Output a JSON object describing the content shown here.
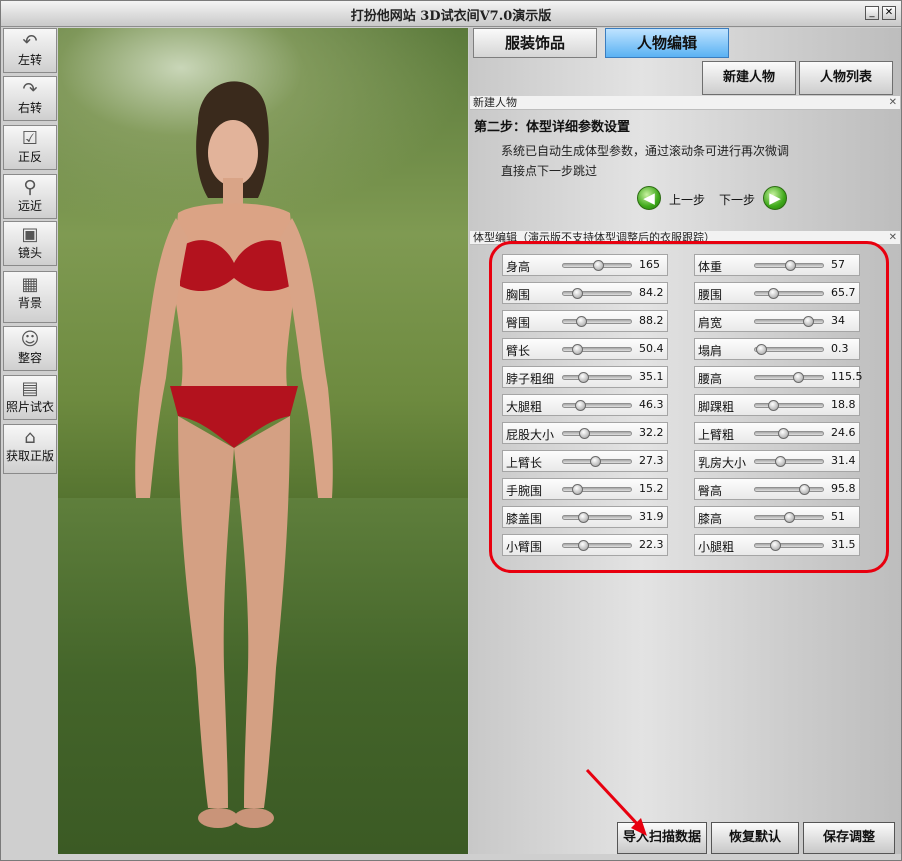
{
  "window": {
    "title": "打扮他网站 3D试衣间V7.0演示版"
  },
  "toolbar": [
    {
      "label": "左转",
      "icon": "rotate-left-icon"
    },
    {
      "label": "右转",
      "icon": "rotate-right-icon"
    },
    {
      "label": "正反",
      "icon": "flip-icon"
    },
    {
      "label": "远近",
      "icon": "zoom-icon"
    },
    {
      "label": "镜头",
      "icon": "camera-icon"
    },
    {
      "label": "背景",
      "icon": "background-icon"
    },
    {
      "label": "整容",
      "icon": "face-icon"
    },
    {
      "label": "照片试衣",
      "icon": "film-icon"
    },
    {
      "label": "获取正版",
      "icon": "home-icon"
    }
  ],
  "tabs": {
    "clothing": "服装饰品",
    "person": "人物编辑"
  },
  "top_buttons": {
    "new_person": "新建人物",
    "person_list": "人物列表"
  },
  "section_new": {
    "header": "新建人物",
    "step_title": "第二步：体型详细参数设置",
    "desc1": "系统已自动生成体型参数，通过滚动条可进行再次微调",
    "desc2": "直接点下一步跳过",
    "prev": "上一步",
    "next": "下一步"
  },
  "section_body": {
    "header": "体型编辑（演示版不支持体型调整后的衣服跟踪）"
  },
  "params_left": [
    {
      "name": "身高",
      "value": "165",
      "level": 0.5
    },
    {
      "name": "胸围",
      "value": "84.2",
      "level": 0.2
    },
    {
      "name": "臀围",
      "value": "88.2",
      "level": 0.25
    },
    {
      "name": "臂长",
      "value": "50.4",
      "level": 0.2
    },
    {
      "name": "脖子粗细",
      "value": "35.1",
      "level": 0.28
    },
    {
      "name": "大腿粗",
      "value": "46.3",
      "level": 0.24
    },
    {
      "name": "屁股大小",
      "value": "32.2",
      "level": 0.3
    },
    {
      "name": "上臂长",
      "value": "27.3",
      "level": 0.45
    },
    {
      "name": "手腕围",
      "value": "15.2",
      "level": 0.2
    },
    {
      "name": "膝盖围",
      "value": "31.9",
      "level": 0.28
    },
    {
      "name": "小臂围",
      "value": "22.3",
      "level": 0.28
    }
  ],
  "params_right": [
    {
      "name": "体重",
      "value": "57",
      "level": 0.5
    },
    {
      "name": "腰围",
      "value": "65.7",
      "level": 0.26
    },
    {
      "name": "肩宽",
      "value": "34",
      "level": 0.75
    },
    {
      "name": "塌肩",
      "value": "0.3",
      "level": 0.08
    },
    {
      "name": "腰高",
      "value": "115.5",
      "level": 0.62
    },
    {
      "name": "脚踝粗",
      "value": "18.8",
      "level": 0.26
    },
    {
      "name": "上臂粗",
      "value": "24.6",
      "level": 0.4
    },
    {
      "name": "乳房大小",
      "value": "31.4",
      "level": 0.35
    },
    {
      "name": "臀高",
      "value": "95.8",
      "level": 0.7
    },
    {
      "name": "膝高",
      "value": "51",
      "level": 0.48
    },
    {
      "name": "小腿粗",
      "value": "31.5",
      "level": 0.28
    }
  ],
  "bottom_buttons": {
    "import": "导入扫描数据",
    "reset": "恢复默认",
    "save": "保存调整"
  },
  "colors": {
    "highlight": "#e8000f",
    "active_tab": "#5ab2f3",
    "nav_green": "#3ea81a"
  }
}
